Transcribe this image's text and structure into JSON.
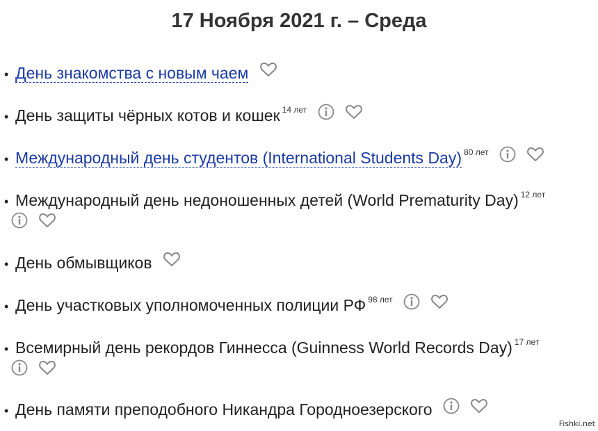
{
  "page": {
    "title": "17 Ноября 2021 г. – Среда"
  },
  "bullet": "•",
  "holidays": [
    {
      "name": "День знакомства с новым чаем",
      "years": ""
    },
    {
      "name": "День защиты чёрных котов и кошек",
      "years": "14 лет"
    },
    {
      "name": "Международный день студентов (International Students Day)",
      "years": "80 лет"
    },
    {
      "name": "Международный день недоношенных детей (World Prematurity Day)",
      "years": "12 лет"
    },
    {
      "name": "День обмывщиков",
      "years": ""
    },
    {
      "name": "День участковых уполномоченных полиции РФ",
      "years": "98 лет"
    },
    {
      "name": "Всемирный день рекордов Гиннесса (Guinness World Records Day)",
      "years": "17 лет"
    },
    {
      "name": "День памяти преподобного Никандра Городноезерского",
      "years": ""
    }
  ],
  "icons": {
    "info": "info-icon",
    "favorite": "heart-icon"
  },
  "colors": {
    "link": "#1a3aa6",
    "text": "#222222",
    "icon": "#888888"
  },
  "watermark": "Fishki.net"
}
